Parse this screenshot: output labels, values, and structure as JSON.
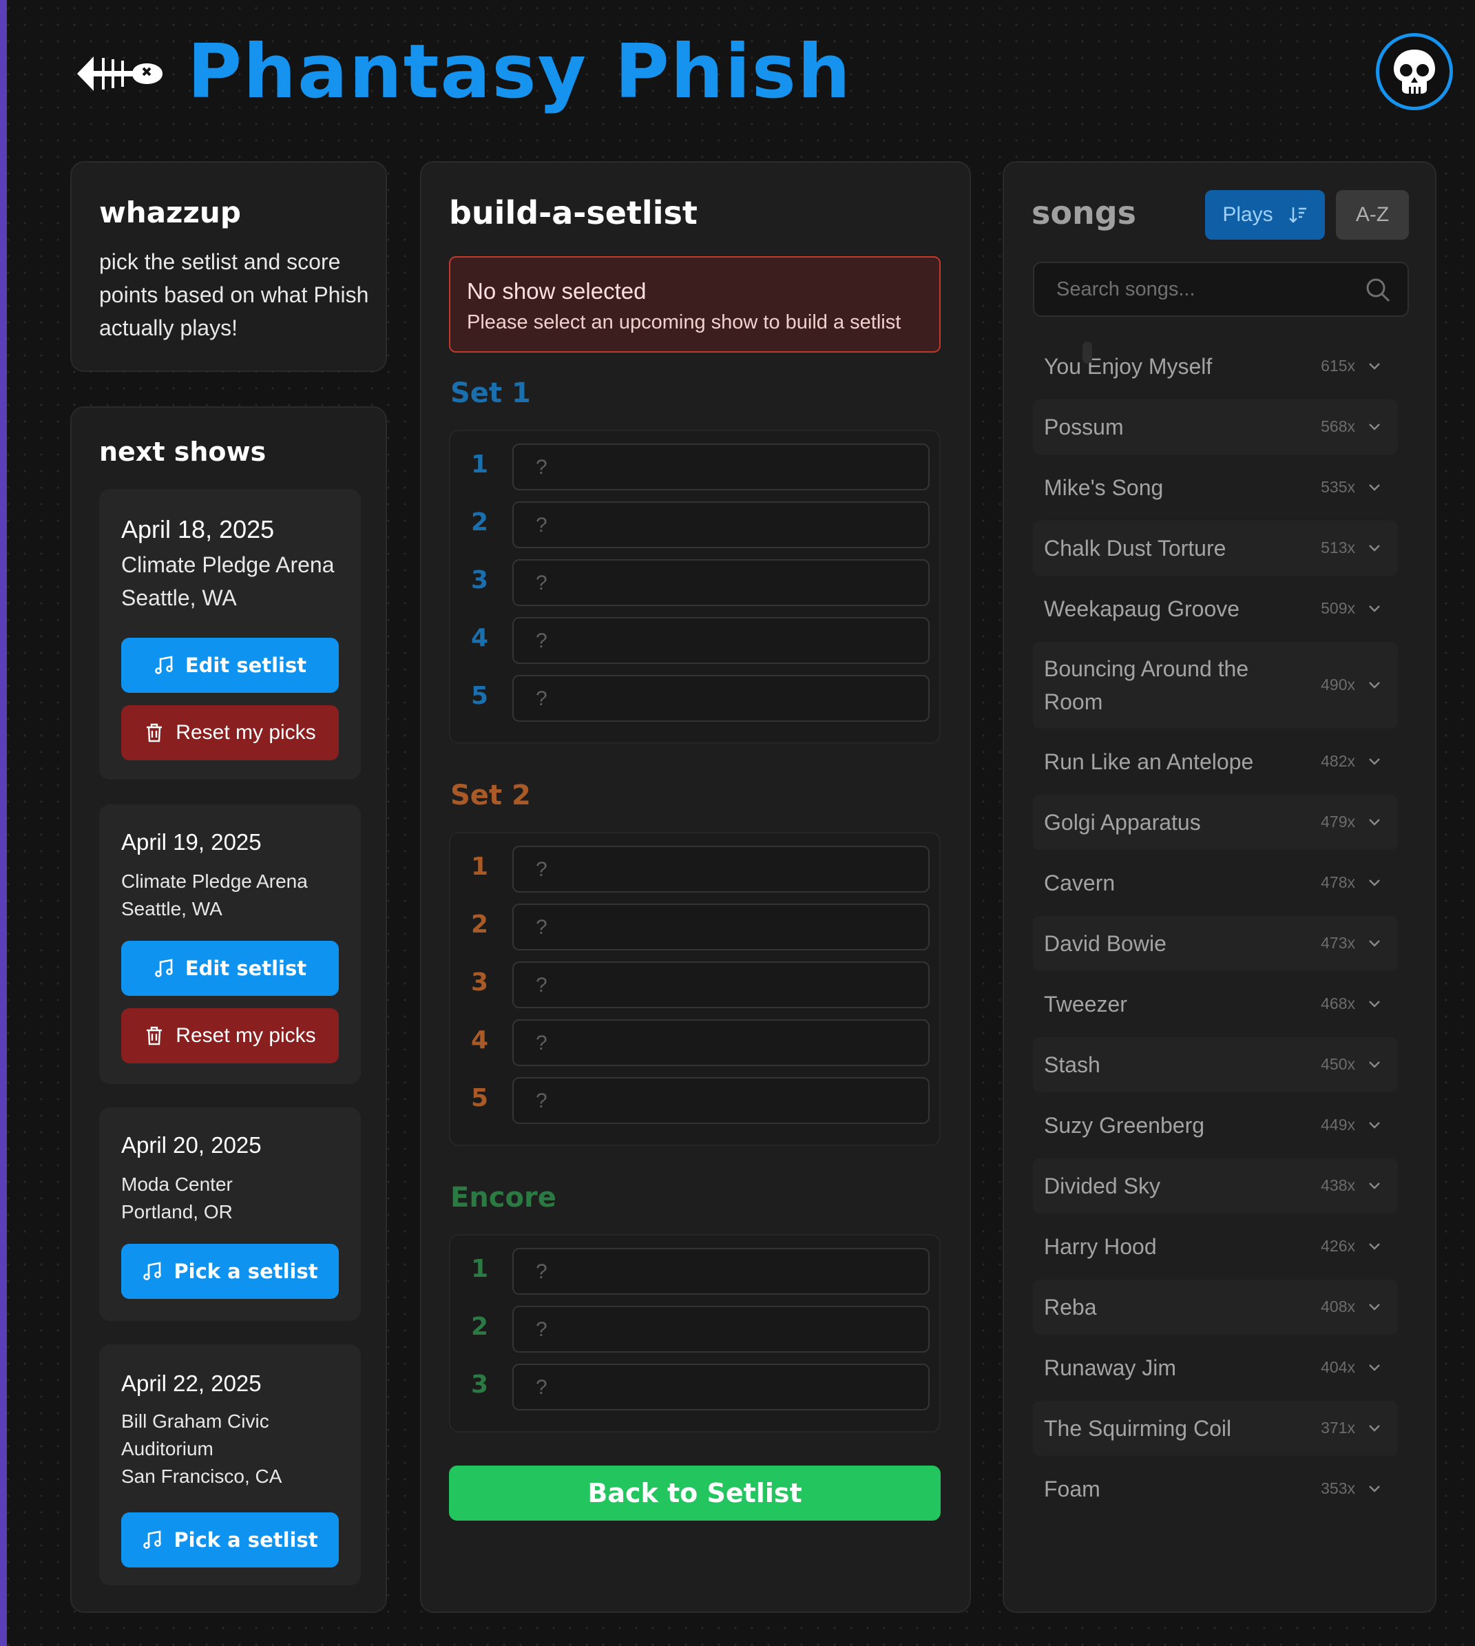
{
  "header": {
    "title": "Phantasy Phish",
    "logo_icon": "fishbone-icon",
    "avatar_icon": "skull-icon",
    "accent_color": "#1593ee"
  },
  "whazzup": {
    "title": "whazzup",
    "description": "pick the setlist and score points based on what Phish actually plays!"
  },
  "next_shows": {
    "title": "next shows",
    "shows": [
      {
        "date": "April 18, 2025",
        "venue": "Climate Pledge Arena",
        "city": "Seattle, WA",
        "primary_label": "Edit setlist",
        "reset_label": "Reset my picks"
      },
      {
        "date": "April 19, 2025",
        "venue": "Climate Pledge Arena",
        "city": "Seattle, WA",
        "primary_label": "Edit setlist",
        "reset_label": "Reset my picks"
      },
      {
        "date": "April 20, 2025",
        "venue": "Moda Center",
        "city": "Portland, OR",
        "primary_label": "Pick a setlist"
      },
      {
        "date": "April 22, 2025",
        "venue_line1": "Bill Graham Civic",
        "venue_line2": "Auditorium",
        "city": "San Francisco, CA",
        "primary_label": "Pick a setlist"
      }
    ]
  },
  "builder": {
    "title": "build-a-setlist",
    "alert_title": "No show selected",
    "alert_message": "Please select an upcoming show to build a setlist",
    "slot_placeholder": "?",
    "sets": [
      {
        "label": "Set 1",
        "color": "#1a6fae",
        "slots": [
          "1",
          "2",
          "3",
          "4",
          "5"
        ]
      },
      {
        "label": "Set 2",
        "color": "#a95a26",
        "slots": [
          "1",
          "2",
          "3",
          "4",
          "5"
        ]
      },
      {
        "label": "Encore",
        "color": "#2c7a43",
        "slots": [
          "1",
          "2",
          "3"
        ]
      }
    ],
    "back_label": "Back to Setlist"
  },
  "songs": {
    "title": "songs",
    "sort_plays_label": "Plays",
    "sort_az_label": "A-Z",
    "search_placeholder": "Search songs...",
    "items": [
      {
        "name": "You Enjoy Myself",
        "count": "615x"
      },
      {
        "name": "Possum",
        "count": "568x"
      },
      {
        "name": "Mike's Song",
        "count": "535x"
      },
      {
        "name": "Chalk Dust Torture",
        "count": "513x"
      },
      {
        "name": "Weekapaug Groove",
        "count": "509x"
      },
      {
        "name": "Bouncing Around the Room",
        "count": "490x"
      },
      {
        "name": "Run Like an Antelope",
        "count": "482x"
      },
      {
        "name": "Golgi Apparatus",
        "count": "479x"
      },
      {
        "name": "Cavern",
        "count": "478x"
      },
      {
        "name": "David Bowie",
        "count": "473x"
      },
      {
        "name": "Tweezer",
        "count": "468x"
      },
      {
        "name": "Stash",
        "count": "450x"
      },
      {
        "name": "Suzy Greenberg",
        "count": "449x"
      },
      {
        "name": "Divided Sky",
        "count": "438x"
      },
      {
        "name": "Harry Hood",
        "count": "426x"
      },
      {
        "name": "Reba",
        "count": "408x"
      },
      {
        "name": "Runaway Jim",
        "count": "404x"
      },
      {
        "name": "The Squirming Coil",
        "count": "371x"
      },
      {
        "name": "Foam",
        "count": "353x"
      }
    ]
  }
}
